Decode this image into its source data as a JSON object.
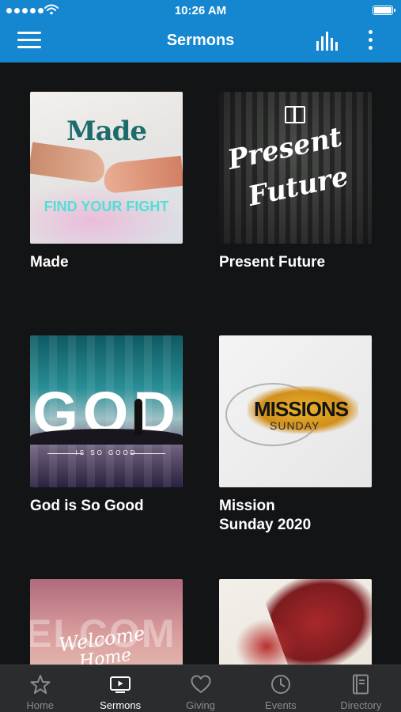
{
  "status_bar": {
    "time": "10:26 AM"
  },
  "nav": {
    "title": "Sermons"
  },
  "sermons": [
    {
      "title": "Made",
      "art_text": [
        "Made",
        "FIND YOUR FIGHT"
      ]
    },
    {
      "title": "Present Future",
      "art_text": [
        "Present",
        "Future"
      ]
    },
    {
      "title": "God is So Good",
      "art_text": [
        "GOD",
        "IS SO GOOD"
      ]
    },
    {
      "title": "Mission\nSunday 2020",
      "art_text": [
        "MISSIONS",
        "SUNDAY"
      ]
    },
    {
      "title": "",
      "art_text": [
        "Welcome",
        "Home"
      ]
    },
    {
      "title": "",
      "art_text": []
    }
  ],
  "tabs": [
    {
      "label": "Home",
      "icon": "star-icon",
      "active": false
    },
    {
      "label": "Sermons",
      "icon": "tv-play-icon",
      "active": true
    },
    {
      "label": "Giving",
      "icon": "heart-icon",
      "active": false
    },
    {
      "label": "Events",
      "icon": "clock-icon",
      "active": false
    },
    {
      "label": "Directory",
      "icon": "book-icon",
      "active": false
    }
  ],
  "colors": {
    "header_blue": "#1487d0",
    "background": "#131416",
    "tab_bar": "#2b2c2e",
    "tab_inactive": "#8a8b8d",
    "tab_active": "#ffffff"
  }
}
